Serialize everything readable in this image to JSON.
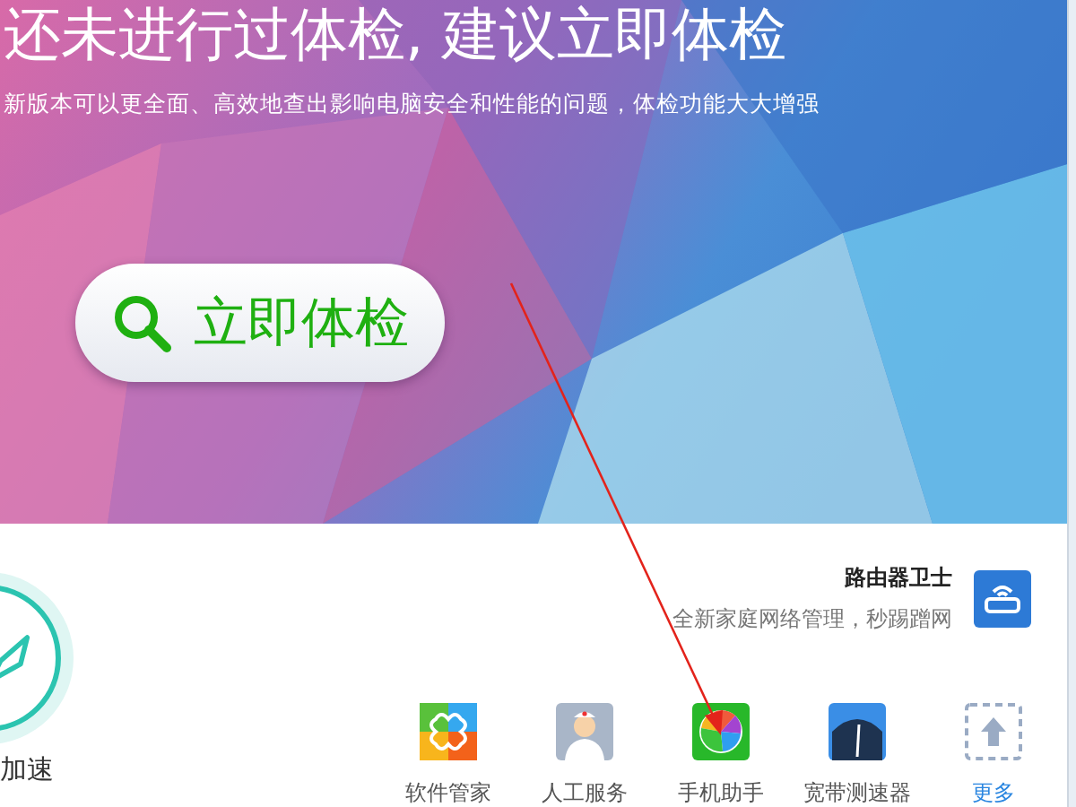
{
  "banner": {
    "title": "还未进行过体检, 建议立即体检",
    "subtitle": "新版本可以更全面、高效地查出影响电脑安全和性能的问题，体检功能大大增强",
    "scan_button": {
      "label": "立即体检"
    }
  },
  "speedup": {
    "label": "加速"
  },
  "router_promo": {
    "title": "路由器卫士",
    "description": "全新家庭网络管理，秒踢蹭网"
  },
  "tools": [
    {
      "kind": "software",
      "label": "软件管家"
    },
    {
      "kind": "service",
      "label": "人工服务"
    },
    {
      "kind": "phone",
      "label": "手机助手"
    },
    {
      "kind": "speedtest",
      "label": "宽带测速器"
    },
    {
      "kind": "more",
      "label": "更多"
    }
  ]
}
